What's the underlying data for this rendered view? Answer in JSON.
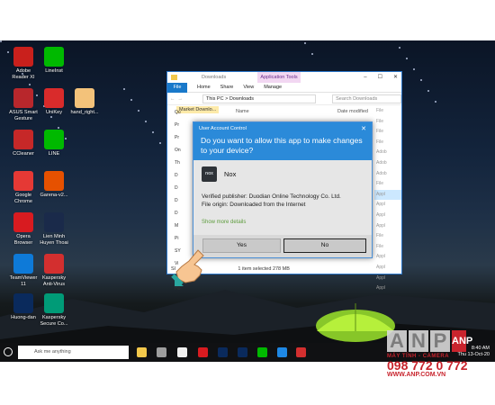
{
  "desktop_icons": [
    {
      "label": "Adobe\nReader XI",
      "icon": "adobe-reader-icon",
      "color": "#c9201c"
    },
    {
      "label": "LineInst",
      "icon": "line-icon",
      "color": "#00b900"
    },
    {
      "label": "ASUS Smart\nGesture",
      "icon": "asus-gesture-icon",
      "color": "#b8272c"
    },
    {
      "label": "UniKey",
      "icon": "unikey-icon",
      "color": "#d92b2b"
    },
    {
      "label": "hand_right...",
      "icon": "hand-right-icon",
      "color": "#f3c27a"
    },
    {
      "label": "CCleaner",
      "icon": "ccleaner-icon",
      "color": "#c62828"
    },
    {
      "label": "LINE",
      "icon": "line-icon",
      "color": "#00b900"
    },
    {
      "label": "Google\nChrome",
      "icon": "chrome-icon",
      "color": "#e53935"
    },
    {
      "label": "Garena-v2...",
      "icon": "garena-icon",
      "color": "#e65100"
    },
    {
      "label": "Opera\nBrowser",
      "icon": "opera-icon",
      "color": "#d81b20"
    },
    {
      "label": "Lien Minh\nHuyen Thoai",
      "icon": "lol-icon",
      "color": "#1a2a4a"
    },
    {
      "label": "TeamViewer\n11",
      "icon": "teamviewer-icon",
      "color": "#0e7ad8"
    },
    {
      "label": "Kaspersky\nAnti-Virus",
      "icon": "kaspersky-icon",
      "color": "#d32f2f"
    },
    {
      "label": "Huong-dan",
      "icon": "photoshop-icon",
      "color": "#0a2a5c"
    },
    {
      "label": "Kaspersky\nSecure Co...",
      "icon": "kaspersky-secure-icon",
      "color": "#009b77"
    }
  ],
  "explorer": {
    "title": "Downloads",
    "app_tools": "Application Tools",
    "ribbon": {
      "file": "File",
      "tabs": [
        "Home",
        "Share",
        "View",
        "Manage"
      ]
    },
    "address": {
      "path": "This PC  >  Downloads",
      "search_placeholder": "Search Downloads"
    },
    "first_item": "Market Downlo...",
    "column_name": "Name",
    "column_date": "Date modified",
    "nav_items": [
      "Qu",
      "Pr",
      "Pr",
      "On",
      "Th",
      "D",
      "D",
      "D",
      "D",
      "M",
      "Pi",
      "SY",
      "Vi",
      "Ne",
      "Ho"
    ],
    "right_column": [
      "File",
      "File",
      "File",
      "File",
      "Adob",
      "Adob",
      "Adob",
      "File",
      "Appl",
      "Appl",
      "Appl",
      "Appl",
      "File",
      "File",
      "Appl",
      "Appl",
      "Appl",
      "Appl"
    ],
    "status_selected": "1 item selected  278 MB",
    "status_prefix": "Sl"
  },
  "uac": {
    "caption": "User Account Control",
    "question": "Do you want to allow this app to make changes to your device?",
    "app_name": "Nox",
    "app_icon_text": "nox",
    "publisher": "Verified publisher: Duodian Online Technology Co. Ltd.",
    "origin": "File origin: Downloaded from the Internet",
    "more": "Show more details",
    "yes": "Yes",
    "no": "No"
  },
  "taskbar": {
    "search_placeholder": "Ask me anything",
    "icons": [
      "file-explorer-icon",
      "browser-icon",
      "folder-icon",
      "opera-icon",
      "photoshop-icon",
      "photoshop-icon",
      "line-icon",
      "edge-icon",
      "kaspersky-icon"
    ],
    "icon_colors": [
      "#f3c84b",
      "#9e9e9e",
      "#f0f0f0",
      "#d81b20",
      "#0a2a5c",
      "#0a2a5c",
      "#00b900",
      "#1e88e5",
      "#d32f2f"
    ],
    "time": "8:40 AM",
    "date": "Thu 13-Oct-20"
  },
  "watermark": {
    "letters": [
      "A",
      "N",
      "P"
    ],
    "reg": "ANP",
    "tagline": "MÁY TÍNH - CAMERA",
    "phone": "098 772 0 772",
    "website": "WWW.ANP.COM.VN"
  },
  "colors": {
    "uac_blue": "#2b8ad9",
    "accent_green": "#5d9c3c",
    "brand_red": "#c8242d"
  }
}
